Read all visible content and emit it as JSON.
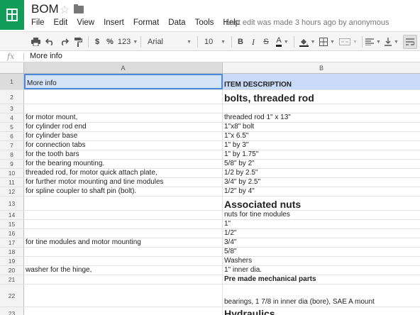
{
  "app": {
    "title": "BOM",
    "last_edit": "Last edit was made 3 hours ago by anonymous",
    "brand_color": "#0f9d58"
  },
  "menu": [
    "File",
    "Edit",
    "View",
    "Insert",
    "Format",
    "Data",
    "Tools",
    "Help"
  ],
  "toolbar": {
    "currency": "$",
    "percent": "%",
    "number_format": "123",
    "font": "Arial",
    "font_size": "10",
    "bold": "B",
    "italic": "I",
    "strikethrough": "S",
    "text_color": "A"
  },
  "formula_bar": {
    "fx": "fx",
    "value": "More info"
  },
  "columns": [
    "A",
    "B"
  ],
  "rows": [
    {
      "num": "1",
      "a": "More info",
      "b": "ITEM DESCRIPTION"
    },
    {
      "num": "2",
      "a": "",
      "b": "bolts, threaded rod"
    },
    {
      "num": "3",
      "a": "",
      "b": ""
    },
    {
      "num": "4",
      "a": "for motor mount,",
      "b": "threaded rod 1\" x 13\""
    },
    {
      "num": "5",
      "a": "for cylinder rod end",
      "b": "1\"x8\" bolt"
    },
    {
      "num": "6",
      "a": "for cylinder base",
      "b": "1\"x 6.5\""
    },
    {
      "num": "7",
      "a": "for connection tabs",
      "b": "1\" by 3\""
    },
    {
      "num": "8",
      "a": "for the tooth bars",
      "b": "1\" by 1.75\""
    },
    {
      "num": "9",
      "a": "for the bearing mounting.",
      "b": "5/8\" by 2\""
    },
    {
      "num": "10",
      "a": "threaded rod, for motor quick attach plate,",
      "b": "1/2 by 2.5\""
    },
    {
      "num": "11",
      "a": "for further motor mounting and tine modules",
      "b": "3/4\" by 2.5\""
    },
    {
      "num": "12",
      "a": "for spline coupler to shaft pin (bolt).",
      "b": "1/2\" by 4\""
    },
    {
      "num": "13",
      "a": "",
      "b": "Associated nuts"
    },
    {
      "num": "14",
      "a": "",
      "b": "nuts for tine modules"
    },
    {
      "num": "15",
      "a": "",
      "b": "1\""
    },
    {
      "num": "16",
      "a": "",
      "b": "1/2\""
    },
    {
      "num": "17",
      "a": "for tine modules and motor mounting",
      "b": "3/4\""
    },
    {
      "num": "18",
      "a": "",
      "b": "5/8\""
    },
    {
      "num": "19",
      "a": "",
      "b": "Washers"
    },
    {
      "num": "20",
      "a": "washer for the hinge,",
      "b": "1\" inner dia."
    },
    {
      "num": "21",
      "a": "",
      "b": "Pre made mechanical parts"
    },
    {
      "num": "22",
      "a": "",
      "b": "bearings, 1 7/8 in inner dia (bore), SAE A mount"
    },
    {
      "num": "23",
      "a": "",
      "b": "Hydraulics"
    }
  ]
}
